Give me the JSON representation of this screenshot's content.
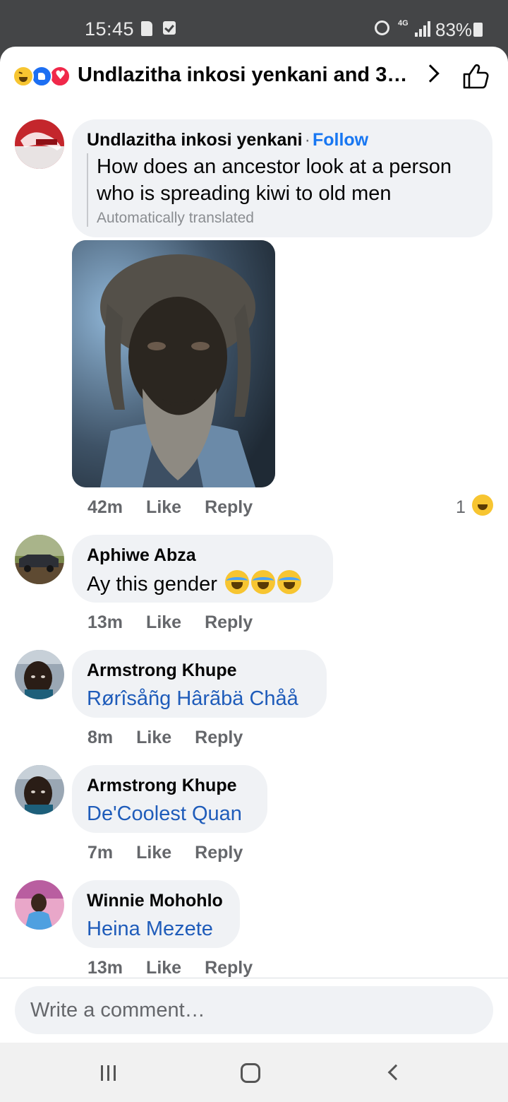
{
  "status_bar": {
    "time": "15:45",
    "network": "4G",
    "battery": "83%",
    "icons": [
      "sd-card-icon",
      "check-notification-icon",
      "alarm-icon",
      "signal-icon",
      "battery-charging-icon"
    ]
  },
  "header": {
    "reaction_icons": [
      "haha-reaction-icon",
      "like-reaction-icon",
      "love-reaction-icon"
    ],
    "title": "Undlazitha inkosi yenkani and 3…",
    "icons": [
      "chevron-right-icon",
      "thumbs-up-icon"
    ]
  },
  "comments": [
    {
      "author": "Undlazitha inkosi yenkani",
      "separator": "·",
      "follow": "Follow",
      "text_line1": "How does an ancestor look at a person",
      "text_line2": "who is spreading kiwi to old men",
      "translated_note": "Automatically translated",
      "time": "42m",
      "like": "Like",
      "reply": "Reply",
      "reaction_count": "1"
    },
    {
      "author": "Aphiwe Abza",
      "text": "Ay this gender",
      "time": "13m",
      "like": "Like",
      "reply": "Reply"
    },
    {
      "author": "Armstrong Khupe",
      "text": "Rørîsåñg Hârãbä Chåå",
      "time": "8m",
      "like": "Like",
      "reply": "Reply"
    },
    {
      "author": "Armstrong Khupe",
      "text": "De'Coolest Quan",
      "time": "7m",
      "like": "Like",
      "reply": "Reply"
    },
    {
      "author": "Winnie Mohohlo",
      "text": "Heina Mezete",
      "time": "13m",
      "like": "Like",
      "reply": "Reply"
    }
  ],
  "composer": {
    "placeholder": "Write a comment…"
  },
  "nav_bar": {
    "icons": [
      "recent-apps-icon",
      "home-icon",
      "back-icon"
    ]
  }
}
